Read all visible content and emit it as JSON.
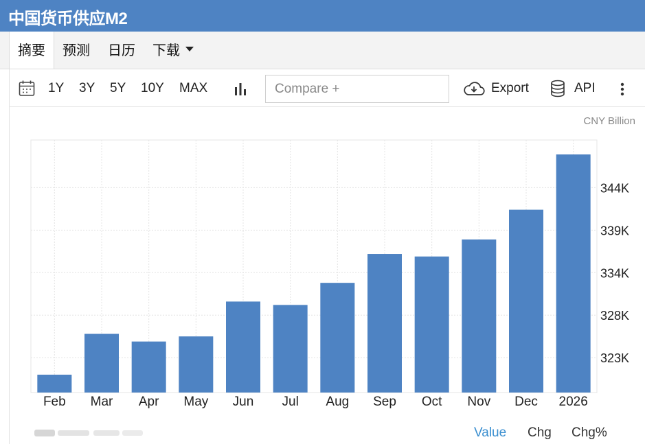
{
  "header": {
    "title": "中国货币供应M2"
  },
  "tabs": [
    {
      "label": "摘要"
    },
    {
      "label": "预测"
    },
    {
      "label": "日历"
    },
    {
      "label": "下载"
    }
  ],
  "toolbar": {
    "ranges": [
      "1Y",
      "3Y",
      "5Y",
      "10Y",
      "MAX"
    ],
    "compare_placeholder": "Compare +",
    "export_label": "Export",
    "api_label": "API"
  },
  "chart_data": {
    "type": "bar",
    "unit": "CNY Billion",
    "categories": [
      "Feb",
      "Mar",
      "Apr",
      "May",
      "Jun",
      "Jul",
      "Aug",
      "Sep",
      "Oct",
      "Nov",
      "Dec",
      "2026"
    ],
    "values": [
      320.9,
      325.7,
      324.8,
      325.4,
      329.5,
      329.1,
      331.7,
      335.1,
      334.8,
      336.8,
      340.3,
      346.8
    ],
    "y_ticks": [
      322.9,
      327.9,
      332.9,
      337.9,
      342.9
    ],
    "y_tick_labels": [
      "323K",
      "328K",
      "334K",
      "339K",
      "344K"
    ],
    "ylim": [
      318.8,
      348.5
    ],
    "grid": true,
    "y_axis_side": "right",
    "colors": {
      "bar": "#4e83c3"
    }
  },
  "footer": {
    "tabs": [
      "Value",
      "Chg",
      "Chg%"
    ],
    "active_color": "#3b8fd0"
  }
}
